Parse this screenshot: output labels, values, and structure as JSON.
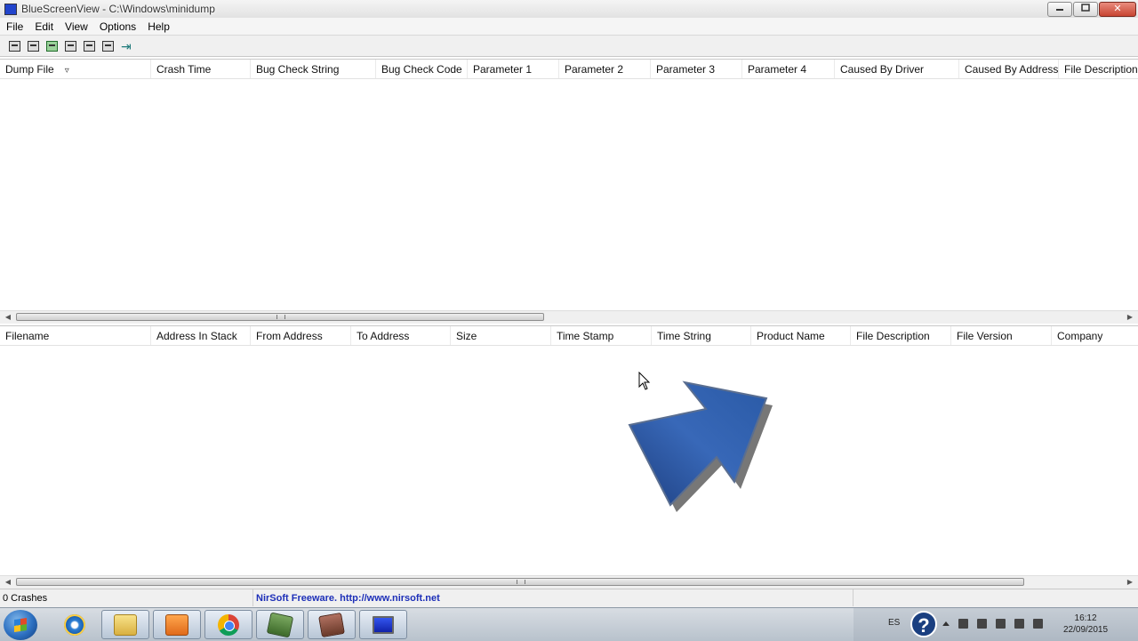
{
  "window": {
    "title": "BlueScreenView - C:\\Windows\\minidump",
    "minimize_label": "▭",
    "maximize_label": "▭",
    "close_label": "✕"
  },
  "menu": {
    "items": [
      {
        "label": "File"
      },
      {
        "label": "Edit"
      },
      {
        "label": "View"
      },
      {
        "label": "Options"
      },
      {
        "label": "Help"
      }
    ]
  },
  "toolbar": {
    "icons": [
      "properties-icon",
      "save-icon",
      "refresh-icon",
      "copy-icon",
      "html-report-icon",
      "find-icon",
      "exit-icon"
    ]
  },
  "crash_list": {
    "columns": [
      {
        "label": "Dump File",
        "sorted": true
      },
      {
        "label": "Crash Time"
      },
      {
        "label": "Bug Check String"
      },
      {
        "label": "Bug Check Code"
      },
      {
        "label": "Parameter 1"
      },
      {
        "label": "Parameter 2"
      },
      {
        "label": "Parameter 3"
      },
      {
        "label": "Parameter 4"
      },
      {
        "label": "Caused By Driver"
      },
      {
        "label": "Caused By Address"
      },
      {
        "label": "File Description"
      }
    ],
    "rows": []
  },
  "driver_list": {
    "columns": [
      {
        "label": "Filename"
      },
      {
        "label": "Address In Stack"
      },
      {
        "label": "From Address"
      },
      {
        "label": "To Address"
      },
      {
        "label": "Size"
      },
      {
        "label": "Time Stamp"
      },
      {
        "label": "Time String"
      },
      {
        "label": "Product Name"
      },
      {
        "label": "File Description"
      },
      {
        "label": "File Version"
      },
      {
        "label": "Company"
      }
    ],
    "rows": []
  },
  "status": {
    "crash_count": "0 Crashes",
    "credit": "NirSoft Freeware.  http://www.nirsoft.net"
  },
  "taskbar": {
    "apps": [
      "internet-explorer-icon",
      "folder-icon",
      "media-player-icon",
      "chrome-icon",
      "app-green-icon",
      "app-red-icon",
      "bluescreenview-icon"
    ],
    "tray": {
      "language": "ES",
      "time": "16:12",
      "date": "22/09/2015"
    }
  },
  "colors": {
    "accent_arrow": "#2d5fa8",
    "link": "#1d2fb8"
  }
}
